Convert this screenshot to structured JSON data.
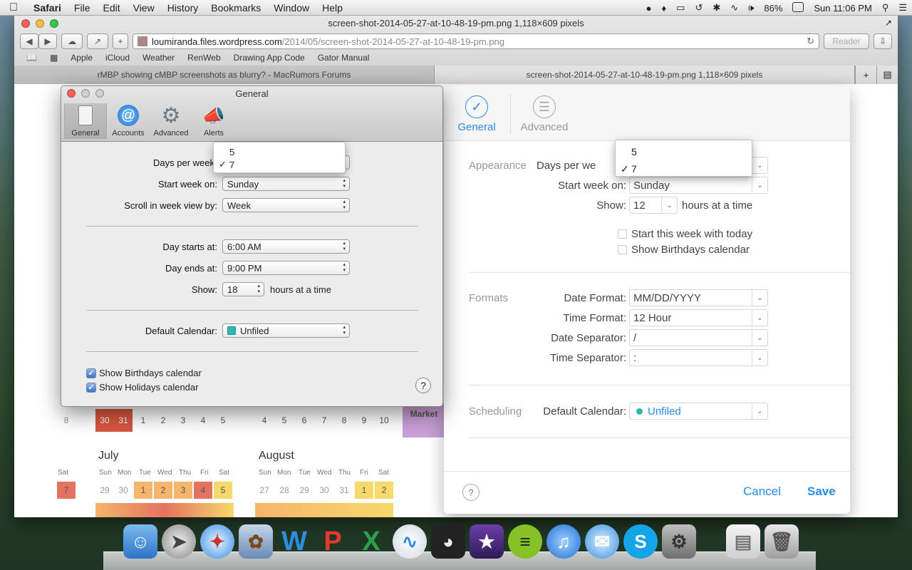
{
  "menubar": {
    "app": "Safari",
    "items": [
      "File",
      "Edit",
      "View",
      "History",
      "Bookmarks",
      "Window",
      "Help"
    ],
    "battery": "86%",
    "clock": "Sun 11:06 PM"
  },
  "window": {
    "title": "screen-shot-2014-05-27-at-10-48-19-pm.png 1,118×609 pixels",
    "url_host": "loumiranda.files.wordpress.com",
    "url_path": "/2014/05/screen-shot-2014-05-27-at-10-48-19-pm.png",
    "reader": "Reader",
    "bookmarks": [
      "Apple",
      "iCloud",
      "Weather",
      "RenWeb",
      "Drawing App Code",
      "Gator Manual"
    ],
    "tabs": [
      "rMBP showing cMBP screenshots as blurry? - MacRumors Forums",
      "screen-shot-2014-05-27-at-10-48-19-pm.png 1,118×609 pixels"
    ]
  },
  "calendar_bg": {
    "months": [
      "July",
      "August"
    ],
    "dow_short": [
      "Sun",
      "Mon",
      "Tue",
      "Wed",
      "Thu",
      "Fri",
      "Sat"
    ],
    "sat_label": "Sat",
    "row_june": [
      "8",
      "30",
      "31",
      "1",
      "2",
      "3",
      "4",
      "5"
    ],
    "row_june2": [
      "4",
      "5",
      "6",
      "7",
      "8",
      "9",
      "10"
    ],
    "july_row1": [
      "29",
      "30",
      "1",
      "2",
      "3",
      "4",
      "5"
    ],
    "aug_row1": [
      "27",
      "28",
      "29",
      "30",
      "31",
      "1",
      "2"
    ],
    "left_sat": "7",
    "market": "Market"
  },
  "old_prefs": {
    "title": "General",
    "tools": [
      "General",
      "Accounts",
      "Advanced",
      "Alerts"
    ],
    "days_per_week_label": "Days per week",
    "days_options": [
      "5",
      "7"
    ],
    "start_week_label": "Start week on:",
    "start_week_value": "Sunday",
    "scroll_label": "Scroll in week view by:",
    "scroll_value": "Week",
    "day_starts_label": "Day starts at:",
    "day_starts_value": "6:00 AM",
    "day_ends_label": "Day ends at:",
    "day_ends_value": "9:00 PM",
    "show_label": "Show:",
    "show_value": "18",
    "show_suffix": "hours at a time",
    "default_cal_label": "Default Calendar:",
    "default_cal_value": "Unfiled",
    "check_birthdays": "Show Birthdays calendar",
    "check_holidays": "Show Holidays calendar",
    "help": "?",
    "accent_color": "#2fb8b0"
  },
  "new_prefs": {
    "tab_general": "General",
    "tab_advanced": "Advanced",
    "section_appearance": "Appearance",
    "days_per_week_label": "Days per we",
    "days_options": [
      "5",
      "7"
    ],
    "start_week_label": "Start week on:",
    "start_week_value": "Sunday",
    "show_label": "Show:",
    "show_value": "12",
    "show_suffix": "hours at a time",
    "check_start_today": "Start this week with today",
    "check_birthdays": "Show Birthdays calendar",
    "section_formats": "Formats",
    "date_format_label": "Date Format:",
    "date_format_value": "MM/DD/YYYY",
    "time_format_label": "Time Format:",
    "time_format_value": "12 Hour",
    "date_sep_label": "Date Separator:",
    "date_sep_value": "/",
    "time_sep_label": "Time Separator:",
    "time_sep_value": ":",
    "section_scheduling": "Scheduling",
    "default_cal_label": "Default Calendar:",
    "default_cal_value": "Unfiled",
    "help": "?",
    "cancel": "Cancel",
    "save": "Save",
    "accent_color": "#2a8ae8"
  }
}
